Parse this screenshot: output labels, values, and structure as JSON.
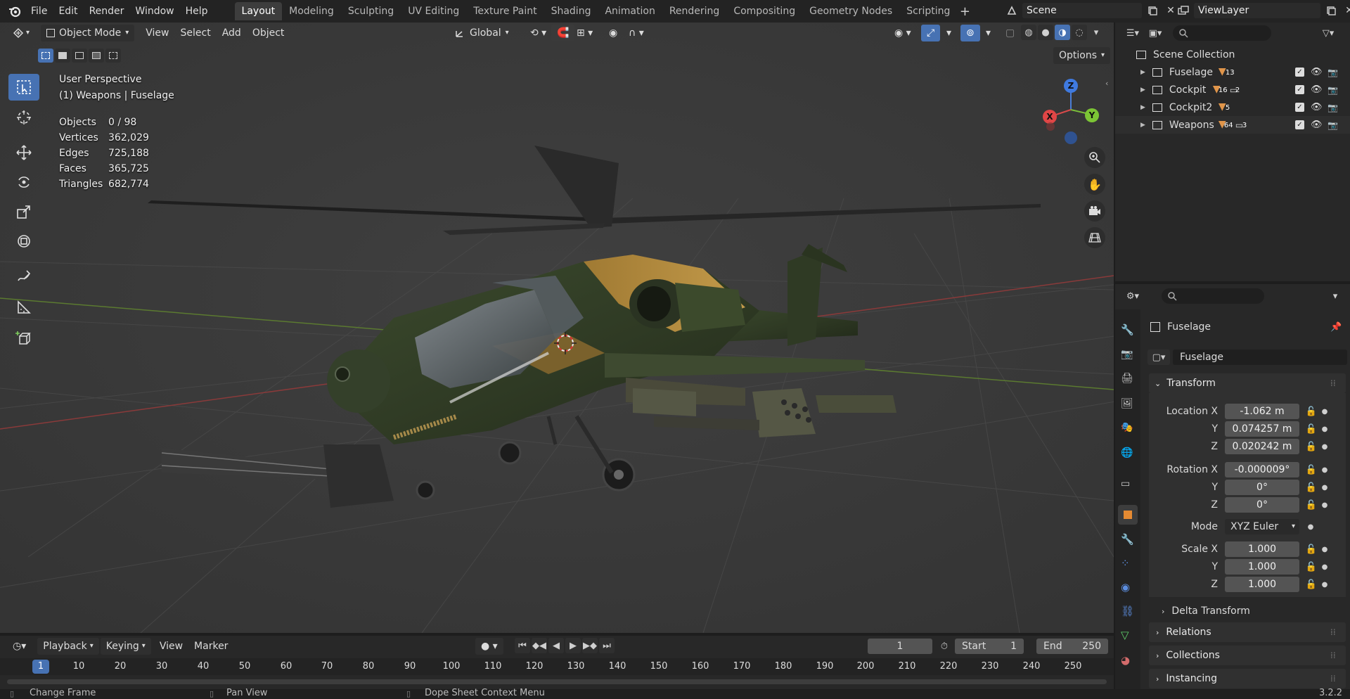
{
  "menus": [
    "File",
    "Edit",
    "Render",
    "Window",
    "Help"
  ],
  "workspaces": [
    "Layout",
    "Modeling",
    "Sculpting",
    "UV Editing",
    "Texture Paint",
    "Shading",
    "Animation",
    "Rendering",
    "Compositing",
    "Geometry Nodes",
    "Scripting"
  ],
  "scene": "Scene",
  "view_layer": "ViewLayer",
  "viewport": {
    "mode": "Object Mode",
    "menu": [
      "View",
      "Select",
      "Add",
      "Object"
    ],
    "orientation": "Global",
    "options_label": "Options",
    "perspective": "User Perspective",
    "context": "(1) Weapons | Fuselage",
    "stats": [
      {
        "label": "Objects",
        "value": "0 / 98"
      },
      {
        "label": "Vertices",
        "value": "362,029"
      },
      {
        "label": "Edges",
        "value": "725,188"
      },
      {
        "label": "Faces",
        "value": "365,725"
      },
      {
        "label": "Triangles",
        "value": "682,774"
      }
    ],
    "gizmo": {
      "z": "Z",
      "x": "X",
      "y": "Y"
    }
  },
  "outliner": {
    "root": "Scene Collection",
    "collections": [
      {
        "name": "Fuselage",
        "badge": "13",
        "badge2": ""
      },
      {
        "name": "Cockpit",
        "badge": "16",
        "badge2": "2"
      },
      {
        "name": "Cockpit2",
        "badge": "5",
        "badge2": ""
      },
      {
        "name": "Weapons",
        "badge": "64",
        "badge2": "3"
      }
    ]
  },
  "properties": {
    "object_name": "Fuselage",
    "data_name": "Fuselage",
    "transform_label": "Transform",
    "location_label": "Location X",
    "rotation_label": "Rotation X",
    "scale_label": "Scale X",
    "mode_label": "Mode",
    "axis_y": "Y",
    "axis_z": "Z",
    "location": [
      "-1.062 m",
      "0.074257 m",
      "0.020242 m"
    ],
    "rotation": [
      "-0.000009°",
      "0°",
      "0°"
    ],
    "rotation_mode": "XYZ Euler",
    "scale": [
      "1.000",
      "1.000",
      "1.000"
    ],
    "delta_label": "Delta Transform",
    "relations_label": "Relations",
    "collections_label": "Collections",
    "instancing_label": "Instancing"
  },
  "timeline": {
    "menus": [
      "Playback",
      "Keying",
      "View",
      "Marker"
    ],
    "current_frame": "1",
    "start_label": "Start",
    "start": "1",
    "end_label": "End",
    "end": "250",
    "ruler_current": "1",
    "ruler": [
      "10",
      "20",
      "30",
      "40",
      "50",
      "60",
      "70",
      "80",
      "90",
      "100",
      "110",
      "120",
      "130",
      "140",
      "150",
      "160",
      "170",
      "180",
      "190",
      "200",
      "210",
      "220",
      "230",
      "240",
      "250"
    ]
  },
  "statusbar": {
    "left": "Change Frame",
    "middle": "Pan View",
    "right": "Dope Sheet Context Menu",
    "version": "3.2.2"
  }
}
